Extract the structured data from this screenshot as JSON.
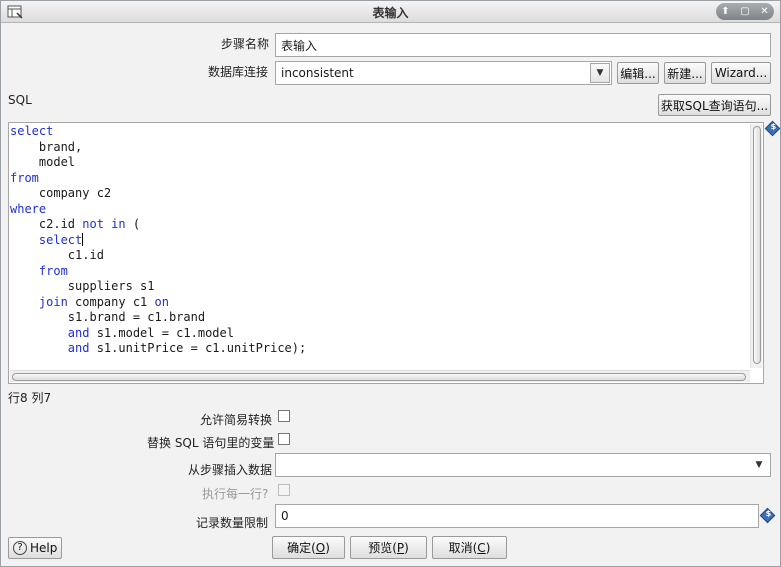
{
  "window": {
    "title": "表输入",
    "controls": [
      "⬆",
      "▢",
      "✕"
    ]
  },
  "form": {
    "step_name_label": "步骤名称",
    "step_name_value": "表输入",
    "db_conn_label": "数据库连接",
    "db_conn_value": "inconsistent",
    "edit_btn": "编辑...",
    "new_btn": "新建...",
    "wizard_btn": "Wizard...",
    "sql_label": "SQL",
    "get_sql_btn": "获取SQL查询语句..."
  },
  "sql_lines": [
    [
      {
        "t": "select",
        "k": true
      }
    ],
    [
      {
        "t": "    brand,"
      }
    ],
    [
      {
        "t": "    model"
      }
    ],
    [
      {
        "t": "from",
        "k": true
      }
    ],
    [
      {
        "t": "    company c2"
      }
    ],
    [
      {
        "t": "where",
        "k": true
      }
    ],
    [
      {
        "t": "    c2.id "
      },
      {
        "t": "not in",
        "k": true
      },
      {
        "t": " ("
      }
    ],
    [
      {
        "t": "    "
      },
      {
        "t": "select",
        "k": true
      },
      {
        "caret": true
      }
    ],
    [
      {
        "t": "        c1.id"
      }
    ],
    [
      {
        "t": "    "
      },
      {
        "t": "from",
        "k": true
      }
    ],
    [
      {
        "t": "        suppliers s1"
      }
    ],
    [
      {
        "t": "    "
      },
      {
        "t": "join",
        "k": true
      },
      {
        "t": " company c1 "
      },
      {
        "t": "on",
        "k": true
      }
    ],
    [
      {
        "t": "        s1.brand = c1.brand"
      }
    ],
    [
      {
        "t": "        "
      },
      {
        "t": "and",
        "k": true
      },
      {
        "t": " s1.model = c1.model"
      }
    ],
    [
      {
        "t": "        "
      },
      {
        "t": "and",
        "k": true
      },
      {
        "t": " s1.unitPrice = c1.unitPrice);"
      }
    ]
  ],
  "status": {
    "cursor_pos": "行8 列7"
  },
  "options": {
    "lazy_conversion_label": "允许简易转换",
    "lazy_conversion_checked": false,
    "replace_vars_label": "替换 SQL 语句里的变量",
    "replace_vars_checked": false,
    "insert_from_step_label": "从步骤插入数据",
    "insert_from_step_value": "",
    "execute_each_row_label": "执行每一行?",
    "execute_each_row_checked": false,
    "limit_label": "记录数量限制",
    "limit_value": "0"
  },
  "footer": {
    "help_btn": "Help",
    "ok_text": "确定(",
    "ok_key": "O",
    "preview_text": "预览(",
    "preview_key": "P",
    "cancel_text": "取消(",
    "cancel_key": "C"
  },
  "colors": {
    "keyword": "#1f2fd6",
    "variable_icon": "#3b6fb6"
  }
}
